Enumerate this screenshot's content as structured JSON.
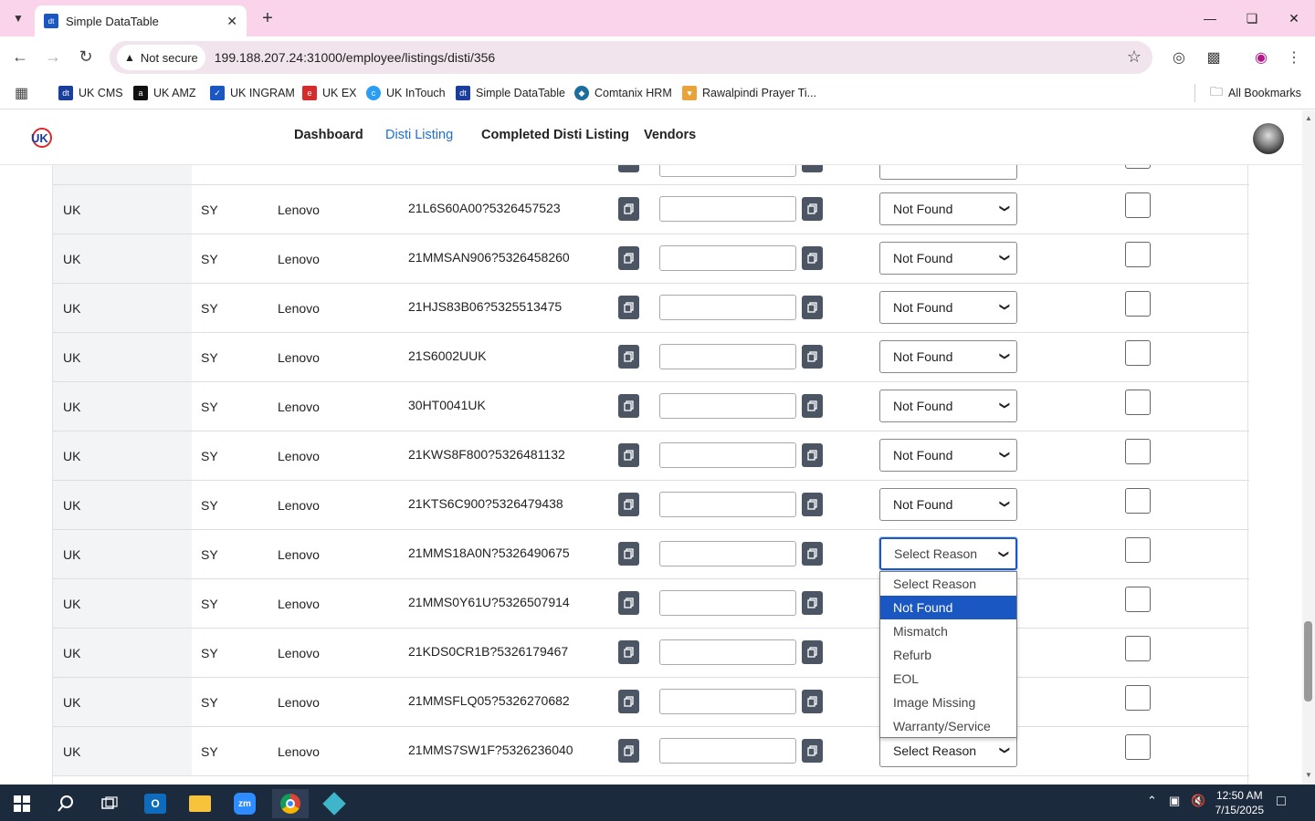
{
  "browser": {
    "tab_title": "Simple DataTable",
    "security_label": "Not secure",
    "url": "199.188.207.24:31000/employee/listings/disti/356",
    "bookmarks": [
      "UK CMS",
      "UK AMZ",
      "UK INGRAM",
      "UK EX",
      "UK InTouch",
      "Simple DataTable",
      "Comtanix HRM",
      "Rawalpindi Prayer Ti..."
    ],
    "all_bookmarks": "All Bookmarks"
  },
  "app": {
    "nav": [
      "Dashboard",
      "Disti Listing",
      "Completed Disti Listing",
      "Vendors"
    ],
    "active_nav": "Disti Listing"
  },
  "table": {
    "rows": [
      {
        "region": "UK",
        "code": "SY",
        "brand": "Lenovo",
        "sku": "21L6S60A00?5326457523",
        "reason": "Not Found"
      },
      {
        "region": "UK",
        "code": "SY",
        "brand": "Lenovo",
        "sku": "21MMSAN906?5326458260",
        "reason": "Not Found"
      },
      {
        "region": "UK",
        "code": "SY",
        "brand": "Lenovo",
        "sku": "21HJS83B06?5325513475",
        "reason": "Not Found"
      },
      {
        "region": "UK",
        "code": "SY",
        "brand": "Lenovo",
        "sku": "21S6002UUK",
        "reason": "Not Found"
      },
      {
        "region": "UK",
        "code": "SY",
        "brand": "Lenovo",
        "sku": "30HT0041UK",
        "reason": "Not Found"
      },
      {
        "region": "UK",
        "code": "SY",
        "brand": "Lenovo",
        "sku": "21KWS8F800?5326481132",
        "reason": "Not Found"
      },
      {
        "region": "UK",
        "code": "SY",
        "brand": "Lenovo",
        "sku": "21KTS6C900?5326479438",
        "reason": "Not Found"
      },
      {
        "region": "UK",
        "code": "SY",
        "brand": "Lenovo",
        "sku": "21MMS18A0N?5326490675",
        "reason": "Select Reason"
      },
      {
        "region": "UK",
        "code": "SY",
        "brand": "Lenovo",
        "sku": "21MMS0Y61U?5326507914",
        "reason": ""
      },
      {
        "region": "UK",
        "code": "SY",
        "brand": "Lenovo",
        "sku": "21KDS0CR1B?5326179467",
        "reason": ""
      },
      {
        "region": "UK",
        "code": "SY",
        "brand": "Lenovo",
        "sku": "21MMSFLQ05?5326270682",
        "reason": ""
      },
      {
        "region": "UK",
        "code": "SY",
        "brand": "Lenovo",
        "sku": "21MMS7SW1F?5326236040",
        "reason": "Select Reason"
      }
    ]
  },
  "dropdown": {
    "options": [
      "Select Reason",
      "Not Found",
      "Mismatch",
      "Refurb",
      "EOL",
      "Image Missing",
      "Warranty/Service"
    ],
    "highlighted": "Not Found"
  },
  "taskbar": {
    "time": "12:50 AM",
    "date": "7/15/2025"
  },
  "colors": {
    "accent": "#1a57c2",
    "nav_active": "#1f6fd1",
    "tab_strip": "#fad4ea",
    "copy_button": "#4b5563"
  }
}
